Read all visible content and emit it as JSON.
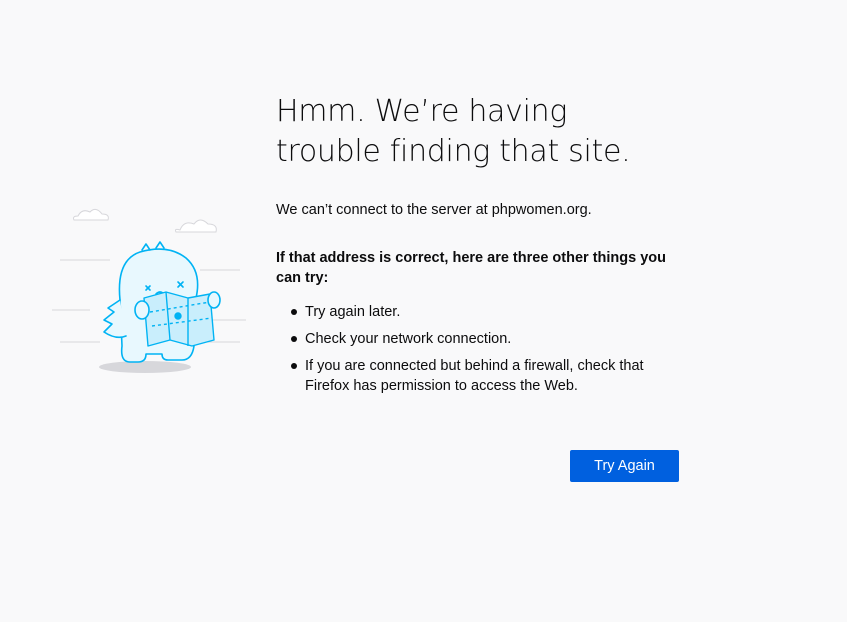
{
  "error": {
    "title": "Hmm. We’re having trouble finding that site.",
    "description": "We can’t connect to the server at phpwomen.org.",
    "advice_heading": "If that address is correct, here are three other things you can try:",
    "advice_items": [
      "Try again later.",
      "Check your network connection.",
      "If you are connected but behind a firewall, check that Firefox has permission to access the Web."
    ],
    "try_again_label": "Try Again"
  },
  "colors": {
    "background": "#f9f9fa",
    "button": "#0060df",
    "illustration": "#00b3f4"
  },
  "illustration": {
    "icon": "lost-monster-with-map-icon"
  }
}
